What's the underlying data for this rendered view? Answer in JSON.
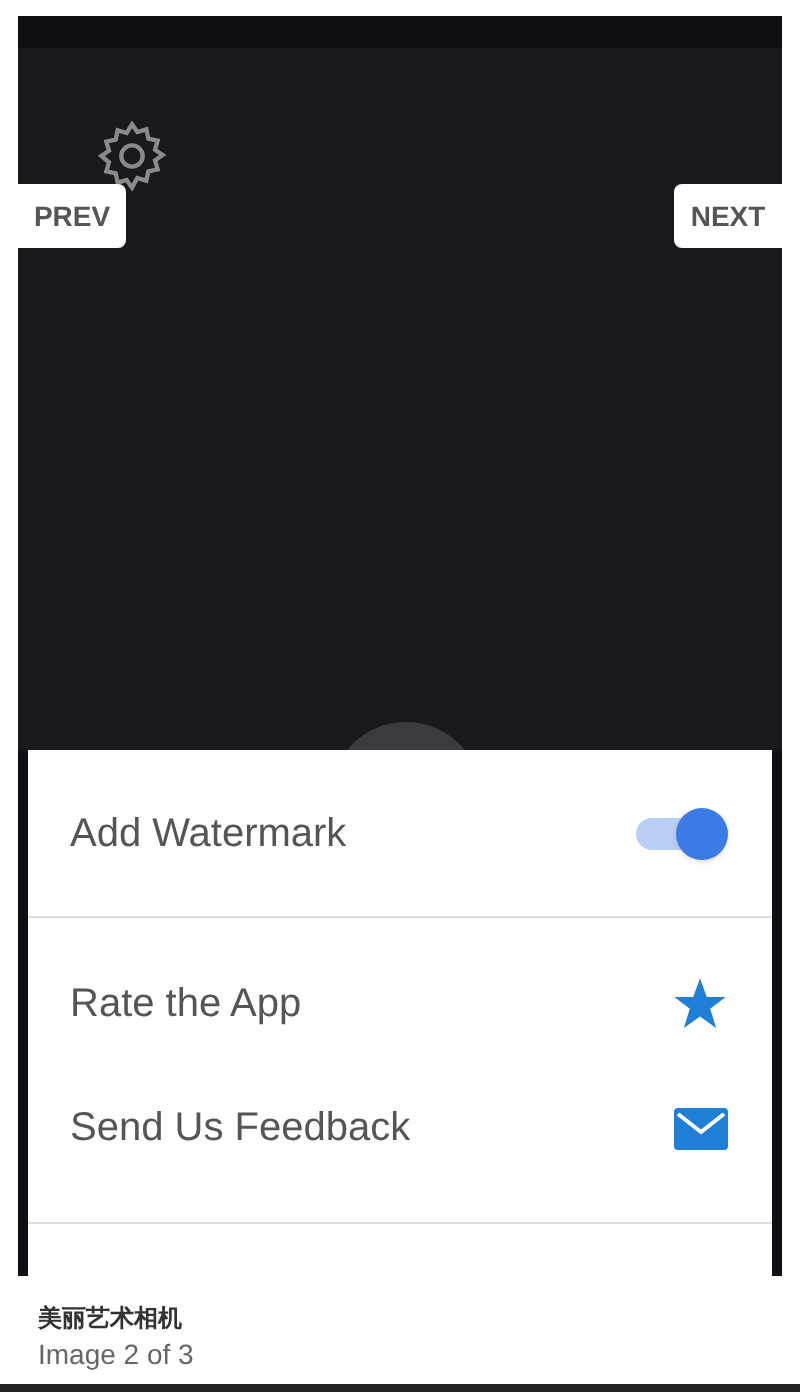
{
  "viewer": {
    "prev": "PREV",
    "next": "NEXT"
  },
  "sheet": {
    "items": [
      {
        "kind": "toggle",
        "label": "Add Watermark",
        "on": true
      },
      {
        "kind": "rate",
        "label": "Rate the App"
      },
      {
        "kind": "feedback",
        "label": "Send Us Feedback"
      }
    ]
  },
  "caption": {
    "title": "美丽艺术相机",
    "counter": "Image 2 of 3"
  }
}
